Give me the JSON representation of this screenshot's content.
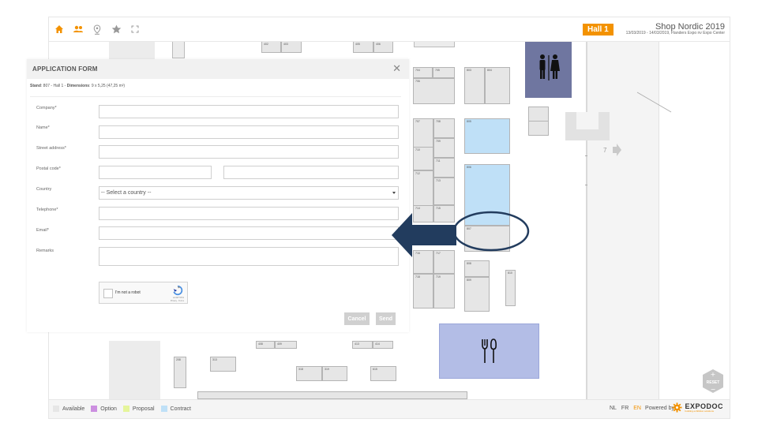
{
  "event": {
    "title": "Shop Nordic 2019",
    "dates": "13/03/2019 - 14/03/2019, Flanders Expo nv Expo Center",
    "hall": "Hall 1"
  },
  "toolbar_icons": [
    "home-icon",
    "users-icon",
    "location-pin-icon",
    "star-icon",
    "fullscreen-icon"
  ],
  "colors": {
    "accent": "#f39200",
    "available": "#e6e6e6",
    "option": "#cc8fe0",
    "proposal": "#e5f59b",
    "contract": "#bfe0f7",
    "restroom_block": "#6f76a0",
    "restaurant_block": "#b3bde6",
    "annotation_dark": "#223c5e"
  },
  "map": {
    "stands": [
      {
        "id": "402",
        "label": "402"
      },
      {
        "id": "403",
        "label": "403"
      },
      {
        "id": "405",
        "label": "405"
      },
      {
        "id": "406",
        "label": "406"
      },
      {
        "id": "704",
        "label": "704"
      },
      {
        "id": "705",
        "label": "705"
      },
      {
        "id": "706",
        "label": "706"
      },
      {
        "id": "803",
        "label": "803"
      },
      {
        "id": "804",
        "label": "804"
      },
      {
        "id": "707",
        "label": "707"
      },
      {
        "id": "708",
        "label": "708"
      },
      {
        "id": "709",
        "label": "709"
      },
      {
        "id": "710",
        "label": "710"
      },
      {
        "id": "711",
        "label": "711"
      },
      {
        "id": "712",
        "label": "712"
      },
      {
        "id": "713",
        "label": "713"
      },
      {
        "id": "714",
        "label": "714"
      },
      {
        "id": "715",
        "label": "715"
      },
      {
        "id": "716",
        "label": "716"
      },
      {
        "id": "717",
        "label": "717"
      },
      {
        "id": "718",
        "label": "718"
      },
      {
        "id": "719",
        "label": "719"
      },
      {
        "id": "805",
        "label": "805"
      },
      {
        "id": "806",
        "label": "806"
      },
      {
        "id": "807",
        "label": "807"
      },
      {
        "id": "808",
        "label": "808"
      },
      {
        "id": "809",
        "label": "809"
      },
      {
        "id": "810",
        "label": "810"
      },
      {
        "id": "408",
        "label": "408"
      },
      {
        "id": "409",
        "label": "409"
      },
      {
        "id": "413",
        "label": "413"
      },
      {
        "id": "414",
        "label": "414"
      },
      {
        "id": "208",
        "label": "208"
      },
      {
        "id": "313",
        "label": "313"
      },
      {
        "id": "318",
        "label": "318"
      },
      {
        "id": "319",
        "label": "319"
      },
      {
        "id": "615",
        "label": "615"
      }
    ],
    "entrance_label": "7"
  },
  "form": {
    "title": "APPLICATION FORM",
    "stand_label": "Stand",
    "stand_value": "807",
    "hall_value": "Hall 1",
    "dimensions_label": "Dimensions",
    "dimensions_value": "9 x 5,25 (47,25 m²)",
    "fields": {
      "company": "Company*",
      "name": "Name*",
      "street": "Street address*",
      "postal": "Postal code*",
      "country": "Country",
      "telephone": "Telephone*",
      "email": "Email*",
      "remarks": "Remarks"
    },
    "country_selected": "-- Select a country --",
    "captcha": {
      "text": "I'm not a robot",
      "brand": "reCAPTCHA",
      "links": "Privacy - Terms"
    },
    "cancel_label": "Cancel",
    "send_label": "Send"
  },
  "legend": [
    {
      "label": "Available",
      "color": "#e6e6e6"
    },
    {
      "label": "Option",
      "color": "#cc8fe0"
    },
    {
      "label": "Proposal",
      "color": "#e5f59b"
    },
    {
      "label": "Contract",
      "color": "#bfe0f7"
    }
  ],
  "footer": {
    "languages": [
      "NL",
      "FR",
      "EN"
    ],
    "active_language": "EN",
    "powered_by": "Powered by",
    "brand": "EXPODOC",
    "brand_tagline": "building exhibition solutions"
  },
  "reset_label": "RESET"
}
